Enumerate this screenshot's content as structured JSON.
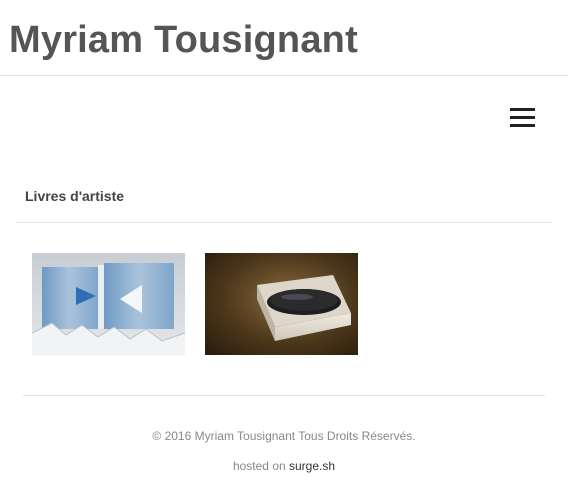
{
  "header": {
    "site_title": "Myriam Tousignant"
  },
  "nav": {
    "menu_icon": "hamburger-menu-icon"
  },
  "section": {
    "title": "Livres d'artiste"
  },
  "gallery": {
    "items": [
      {
        "image": "artist-book-blue-arrows"
      },
      {
        "image": "artist-book-box-disc"
      }
    ]
  },
  "footer": {
    "copyright": "© 2016 Myriam Tousignant Tous Droits Réservés.",
    "hosted_prefix": "hosted on ",
    "hosted_link": "surge.sh"
  }
}
